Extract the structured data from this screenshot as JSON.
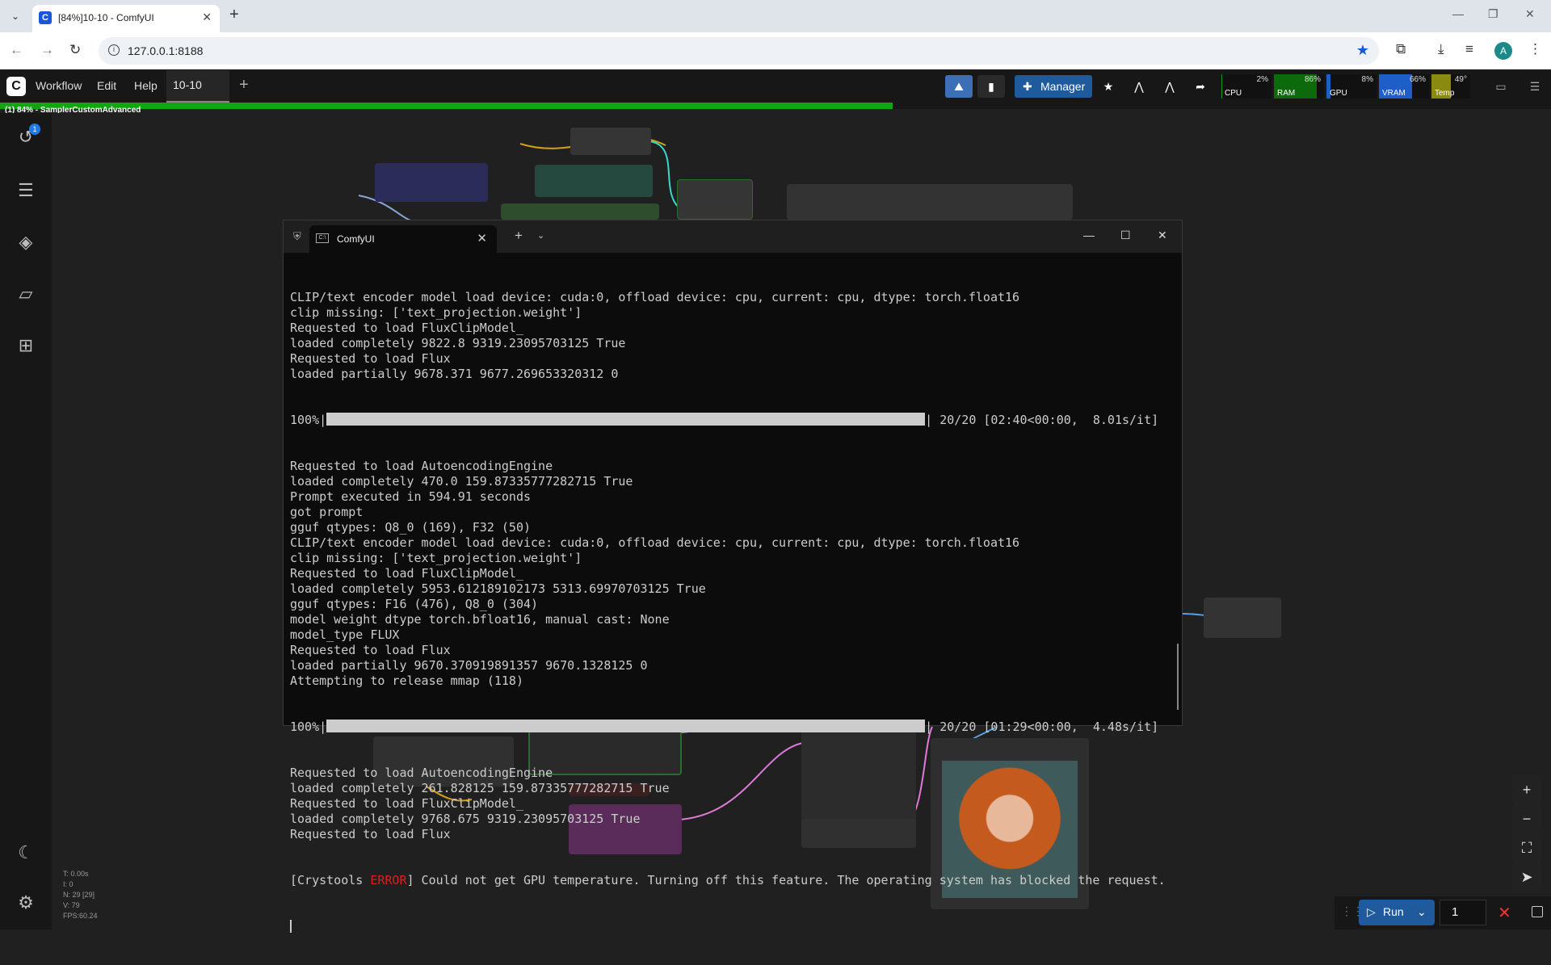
{
  "browser": {
    "tab_title": "[84%]10-10 - ComfyUI",
    "favicon_letter": "C",
    "url": "127.0.0.1:8188",
    "avatar_letter": "A"
  },
  "comfy": {
    "logo_letter": "C",
    "menu": [
      "Workflow",
      "Edit",
      "Help"
    ],
    "workflow_tab": "10-10",
    "manager_label": "Manager",
    "monitors": [
      {
        "label": "CPU",
        "value": "2%",
        "fill": 0.02,
        "color": "#1a9a1a"
      },
      {
        "label": "RAM",
        "value": "86%",
        "fill": 0.86,
        "color": "#0c6a0c"
      },
      {
        "label": "GPU",
        "value": "8%",
        "fill": 0.08,
        "color": "#1e5ec8"
      },
      {
        "label": "VRAM",
        "value": "66%",
        "fill": 0.66,
        "color": "#1e5ec8"
      },
      {
        "label": "Temp",
        "value": "49°",
        "fill": 0.49,
        "color": "#8a8a10"
      }
    ],
    "progress_fraction": 0.84,
    "progress_text": "(1) 84% - SamplerCustomAdvanced",
    "queue_badge": "1"
  },
  "canvas": {
    "stats": [
      "T: 0.00s",
      "I: 0",
      "N: 29 [29]",
      "V: 79",
      "FPS:60.24"
    ]
  },
  "terminal": {
    "tab_title": "ComfyUI",
    "lines": [
      "CLIP/text encoder model load device: cuda:0, offload device: cpu, current: cpu, dtype: torch.float16",
      "clip missing: ['text_projection.weight']",
      "Requested to load FluxClipModel_",
      "loaded completely 9822.8 9319.23095703125 True",
      "Requested to load Flux",
      "loaded partially 9678.371 9677.269653320312 0"
    ],
    "progress1": {
      "prefix": "100%|",
      "suffix": "| 20/20 [02:40<00:00,  8.01s/it]"
    },
    "lines2": [
      "Requested to load AutoencodingEngine",
      "loaded completely 470.0 159.87335777282715 True",
      "Prompt executed in 594.91 seconds",
      "got prompt",
      "gguf qtypes: Q8_0 (169), F32 (50)",
      "CLIP/text encoder model load device: cuda:0, offload device: cpu, current: cpu, dtype: torch.float16",
      "clip missing: ['text_projection.weight']",
      "Requested to load FluxClipModel_",
      "loaded completely 5953.612189102173 5313.69970703125 True",
      "gguf qtypes: F16 (476), Q8_0 (304)",
      "model weight dtype torch.bfloat16, manual cast: None",
      "model_type FLUX",
      "Requested to load Flux",
      "loaded partially 9670.370919891357 9670.1328125 0",
      "Attempting to release mmap (118)"
    ],
    "progress2": {
      "prefix": "100%|",
      "suffix": "| 20/20 [01:29<00:00,  4.48s/it]"
    },
    "lines3": [
      "Requested to load AutoencodingEngine",
      "loaded completely 261.828125 159.87335777282715 True",
      "Requested to load FluxClipModel_",
      "loaded completely 9768.675 9319.23095703125 True",
      "Requested to load Flux"
    ],
    "error_line": {
      "pre": "[Crystools ",
      "tag": "ERROR",
      "post": "] Could not get GPU temperature. Turning off this feature. The operating system has blocked the request."
    }
  },
  "runbar": {
    "run_label": "Run",
    "count": "1"
  }
}
